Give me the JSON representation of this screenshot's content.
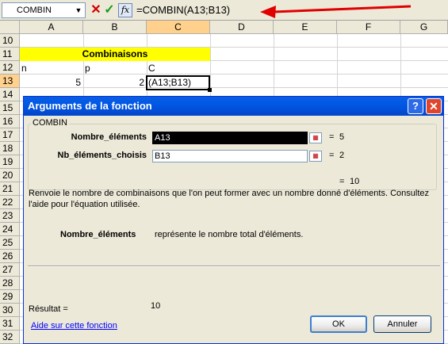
{
  "formula_bar": {
    "name_box": "COMBIN",
    "dropdown_glyph": "▼",
    "cancel_glyph": "✕",
    "enter_glyph": "✓",
    "fx_glyph": "fx",
    "formula": "=COMBIN(A13;B13)"
  },
  "columns": [
    "A",
    "B",
    "C",
    "D",
    "E",
    "F",
    "G"
  ],
  "rows": [
    "10",
    "11",
    "12",
    "13",
    "14",
    "15",
    "16",
    "17",
    "18",
    "19",
    "20",
    "21",
    "22",
    "23",
    "24",
    "25",
    "26",
    "27",
    "28",
    "29",
    "30",
    "31",
    "32"
  ],
  "sheet": {
    "title": "Combinaisons",
    "headers": {
      "a": "n",
      "b": "p",
      "c": "C"
    },
    "values": {
      "a": "5",
      "b": "2",
      "c": "(A13;B13)"
    }
  },
  "colors": {
    "title_fill": "#ffff00",
    "dialog_title": "#0058e6",
    "arrow": "#e00000"
  },
  "dialog": {
    "title": "Arguments de la fonction",
    "help_glyph": "?",
    "close_glyph": "✕",
    "function_name": "COMBIN",
    "args": [
      {
        "label": "Nombre_éléments",
        "value": "A13",
        "result": "5"
      },
      {
        "label": "Nb_éléments_choisis",
        "value": "B13",
        "result": "2"
      }
    ],
    "equals": "=",
    "formula_result": "10",
    "description": "Renvoie le nombre de combinaisons que l'on peut former avec un nombre donné d'éléments. Consultez l'aide pour l'équation utilisée.",
    "arg_help_name": "Nombre_éléments",
    "arg_help_text": "représente le nombre total d'éléments.",
    "result_label": "Résultat =",
    "result_value": "10",
    "help_link": "Aide sur cette fonction",
    "ok_label": "OK",
    "cancel_label": "Annuler"
  }
}
